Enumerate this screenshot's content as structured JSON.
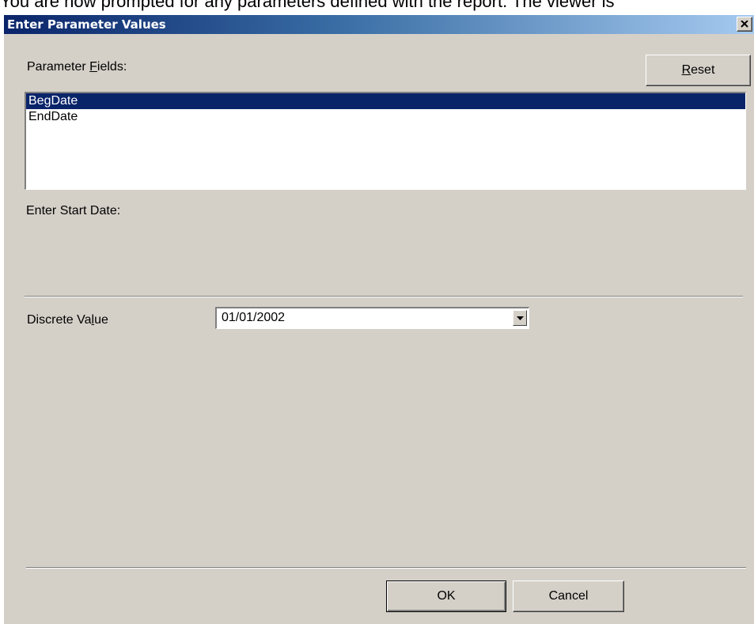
{
  "background_caption": "You are now prompted for any parameters defined with the report. The viewer is",
  "dialog": {
    "title": "Enter Parameter Values",
    "close_label": "×"
  },
  "parameter_fields": {
    "label_pre": "Parameter ",
    "label_key": "F",
    "label_post": "ields:",
    "items": [
      "BegDate",
      "EndDate"
    ],
    "selected_index": 0
  },
  "reset_button": {
    "key": "R",
    "rest": "eset"
  },
  "prompt_text": "Enter Start Date:",
  "discrete_value": {
    "label_pre": "Discrete Va",
    "label_key": "l",
    "label_post": "ue",
    "value": "01/01/2002"
  },
  "footer": {
    "ok_label": "OK",
    "cancel_label": "Cancel"
  },
  "colors": {
    "dialog_face": "#d4d0c8",
    "title_start": "#0a246a",
    "title_end": "#a6caf0",
    "selection": "#0a246a"
  }
}
